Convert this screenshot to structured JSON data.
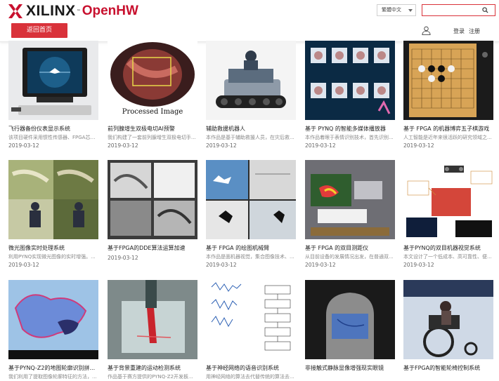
{
  "header": {
    "logo_text": "XILINX",
    "logo_sub": "OpenHW",
    "back_label": "返回首页",
    "lang_value": "繁體中文",
    "search_placeholder": "",
    "login_label": "登录",
    "register_label": "注册"
  },
  "cards": [
    {
      "title": "飞行器备份仪表显示系统",
      "desc": "该项目硬件采用惯性传感器、FPGA芯片...",
      "date": "2019-03-12",
      "thumb": "instrument"
    },
    {
      "title": "前列腺增生双极电切AI预警",
      "desc": "我们构建了一套前列腺增生双极电切手...",
      "date": "2019-03-12",
      "thumb": "medical"
    },
    {
      "title": "辅助救援机器人",
      "desc": "本作品是基于辅助救援人员，在灾后救...",
      "date": "2019-03-12",
      "thumb": "robot"
    },
    {
      "title": "基于 PYNQ 的智能多媒体播放器",
      "desc": "本作品着眼于表情识别技术，首先识别...",
      "date": "2019-03-12",
      "thumb": "media"
    },
    {
      "title": "基于 FPGA 的机器博弈五子棋游戏",
      "desc": "人工智能是近年来很活跃的研究领域之...",
      "date": "2019-03-12",
      "thumb": "gomoku"
    },
    {
      "title": "微光图像实时处理系统",
      "desc": "利用PYNQ实现微光图像的实时增强。...",
      "date": "2019-03-12",
      "thumb": "lowlight"
    },
    {
      "title": "基于FPGA的DDE算法运算加速",
      "desc": "",
      "date": "2019-03-12",
      "thumb": "dde"
    },
    {
      "title": "基于 FPGA 的绘图机械臂",
      "desc": "本作品是面机器视觉，集合图像技术、...",
      "date": "2019-03-12",
      "thumb": "drawarm"
    },
    {
      "title": "基于 FPGA 的双目测距仪",
      "desc": "从目前设备的发展情况出发，在普通双...",
      "date": "2019-03-12",
      "thumb": "stereo"
    },
    {
      "title": "基于PYNQ的双目机器视觉系统",
      "desc": "本文设计了一个低成本、高可靠性、便...",
      "date": "2019-03-12",
      "thumb": "binocular"
    },
    {
      "title": "基于PYNQ-Z2的地图轮廓识别拼...",
      "desc": "我们利用了提取图像轮廓特征的方法，...",
      "date": "2019-03-12",
      "thumb": "mapcontour"
    },
    {
      "title": "基于背景重建的运动检测系统",
      "desc": "作品基于赛方提供的PYNQ-Z2开发板...",
      "date": "2019-03-12",
      "thumb": "motion"
    },
    {
      "title": "基于神经网络的语音识别系统",
      "desc": "用神经网络的算法去代替传统的算法去...",
      "date": "2019-03-12",
      "thumb": "speech"
    },
    {
      "title": "非接触式静脉显像增强现实眼镜",
      "desc": "",
      "date": "",
      "thumb": "vein"
    },
    {
      "title": "基于FPGA的智能轮椅控制系统",
      "desc": "",
      "date": "",
      "thumb": "wheelchair"
    }
  ]
}
